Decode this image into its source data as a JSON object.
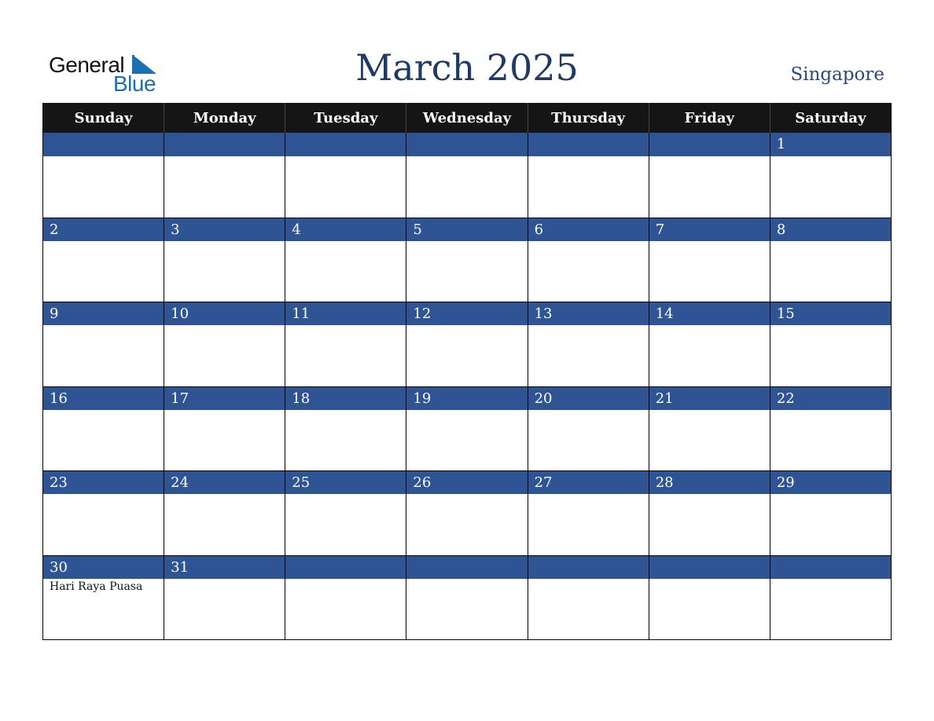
{
  "logo": {
    "line1": "General",
    "line2": "Blue",
    "accent_color": "#1a6fb5"
  },
  "header": {
    "title": "March 2025",
    "country": "Singapore"
  },
  "colors": {
    "header_bg": "#151515",
    "date_bar": "#2e5494",
    "title": "#1f3a63"
  },
  "weekdays": [
    "Sunday",
    "Monday",
    "Tuesday",
    "Wednesday",
    "Thursday",
    "Friday",
    "Saturday"
  ],
  "weeks": [
    [
      {
        "day": "",
        "event": ""
      },
      {
        "day": "",
        "event": ""
      },
      {
        "day": "",
        "event": ""
      },
      {
        "day": "",
        "event": ""
      },
      {
        "day": "",
        "event": ""
      },
      {
        "day": "",
        "event": ""
      },
      {
        "day": "1",
        "event": ""
      }
    ],
    [
      {
        "day": "2",
        "event": ""
      },
      {
        "day": "3",
        "event": ""
      },
      {
        "day": "4",
        "event": ""
      },
      {
        "day": "5",
        "event": ""
      },
      {
        "day": "6",
        "event": ""
      },
      {
        "day": "7",
        "event": ""
      },
      {
        "day": "8",
        "event": ""
      }
    ],
    [
      {
        "day": "9",
        "event": ""
      },
      {
        "day": "10",
        "event": ""
      },
      {
        "day": "11",
        "event": ""
      },
      {
        "day": "12",
        "event": ""
      },
      {
        "day": "13",
        "event": ""
      },
      {
        "day": "14",
        "event": ""
      },
      {
        "day": "15",
        "event": ""
      }
    ],
    [
      {
        "day": "16",
        "event": ""
      },
      {
        "day": "17",
        "event": ""
      },
      {
        "day": "18",
        "event": ""
      },
      {
        "day": "19",
        "event": ""
      },
      {
        "day": "20",
        "event": ""
      },
      {
        "day": "21",
        "event": ""
      },
      {
        "day": "22",
        "event": ""
      }
    ],
    [
      {
        "day": "23",
        "event": ""
      },
      {
        "day": "24",
        "event": ""
      },
      {
        "day": "25",
        "event": ""
      },
      {
        "day": "26",
        "event": ""
      },
      {
        "day": "27",
        "event": ""
      },
      {
        "day": "28",
        "event": ""
      },
      {
        "day": "29",
        "event": ""
      }
    ],
    [
      {
        "day": "30",
        "event": "Hari Raya Puasa"
      },
      {
        "day": "31",
        "event": ""
      },
      {
        "day": "",
        "event": ""
      },
      {
        "day": "",
        "event": ""
      },
      {
        "day": "",
        "event": ""
      },
      {
        "day": "",
        "event": ""
      },
      {
        "day": "",
        "event": ""
      }
    ]
  ]
}
